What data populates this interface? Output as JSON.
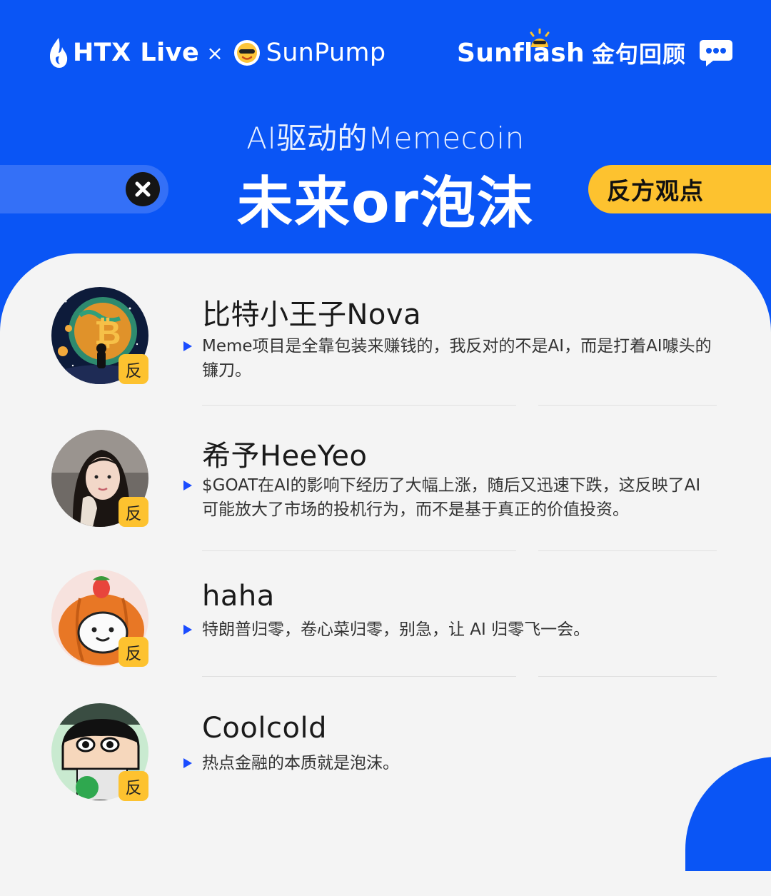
{
  "header": {
    "htx_brand": "HTX Live",
    "times_sign": "×",
    "sunpump_brand": "SunPump",
    "sunflash_brand": "Sunflash",
    "sunflash_tagline": "金句回顾",
    "subtitle": "AI驱动的Memecoin",
    "title": "未来or泡沫",
    "side_label": "反方观点"
  },
  "colors": {
    "brand_blue": "#0a55f5",
    "accent_yellow": "#fdc22f",
    "card_bg": "#f4f4f4",
    "bullet_blue": "#1a4cff"
  },
  "entries": [
    {
      "name": "比特小王子Nova",
      "tag": "反",
      "quote": "Meme项目是全靠包装来赚钱的，我反对的不是AI，而是打着AI噱头的镰刀。",
      "avatar_icon": "bitcoin-planet-avatar"
    },
    {
      "name": "希予HeeYeo",
      "tag": "反",
      "quote": "$GOAT在AI的影响下经历了大幅上涨，随后又迅速下跌，这反映了AI可能放大了市场的投机行为，而不是基于真正的价值投资。",
      "avatar_icon": "portrait-photo-avatar"
    },
    {
      "name": "haha",
      "tag": "反",
      "quote": "特朗普归零，卷心菜归零，别急，让 AI 归零飞一会。",
      "avatar_icon": "pumpkin-cartoon-avatar"
    },
    {
      "name": "Coolcold",
      "tag": "反",
      "quote": "热点金融的本质就是泡沫。",
      "avatar_icon": "cartoon-boy-avatar"
    }
  ]
}
